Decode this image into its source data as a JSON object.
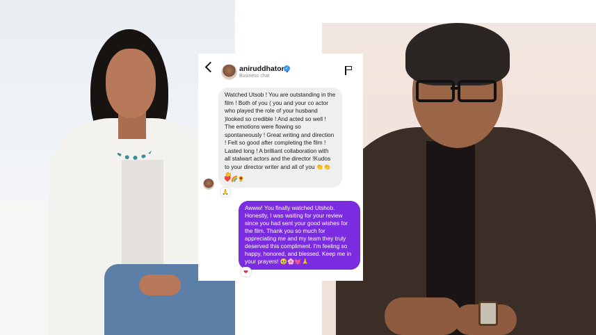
{
  "header": {
    "username": "aniruddhatony",
    "subtitle": "Business chat",
    "verified_badge": "✓"
  },
  "icons": {
    "back": "chevron-left-icon",
    "report": "flag-icon",
    "verified": "verified-icon"
  },
  "messages": {
    "incoming": {
      "text": "Watched Utsob ! You are outstanding in the film ! Both of you ( you and your co actor who played the role of your husband )looked so credible ! And acted so well ! The emotions were flowing so spontaneously ! Great writing and direction ! Felt so good after completing the film ! Lasted long ! A brilliant collaboration with all stalwart actors and the director !Kudos to your director writer and all of you 👏👏👏",
      "emoji_line": "❤️🌈🌻",
      "reaction": "🙏"
    },
    "outgoing": {
      "text": "Awww! You finally watched Utshob. Honestly, I was waiting for your review since you had sent your good wishes for the film. Thank you so much for appreciating me and my team they truly deserved this compliment. I'm feeling so happy, honored, and blessed. Keep me in your prayers! 🥹🌸💓🙏",
      "reaction": "❤"
    }
  },
  "colors": {
    "outgoing_bubble": "#7b2be0",
    "incoming_bubble": "#efefef",
    "verified": "#3897f0"
  }
}
